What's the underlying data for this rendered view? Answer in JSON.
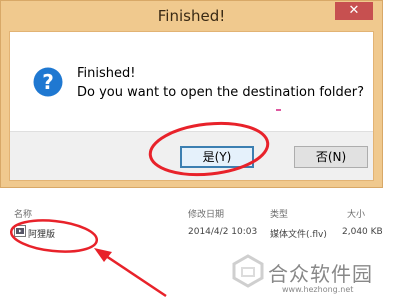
{
  "dialog": {
    "title": "Finished!",
    "close_glyph": "✕",
    "message_line1": "Finished!",
    "message_line2": "Do you want to open the destination folder?",
    "yes_label": "是(Y)",
    "no_label": "否(N)"
  },
  "file_list": {
    "columns": [
      "名称",
      "修改日期",
      "类型",
      "大小"
    ],
    "rows": [
      {
        "name": "阿狸版",
        "modified": "2014/4/2 10:03",
        "type": "媒体文件(.flv)",
        "size": "2,040 KB"
      }
    ]
  },
  "watermark": {
    "text": "合众软件园",
    "url": "www.hezhong.net"
  },
  "colors": {
    "frame": "#f0c98e",
    "close_button": "#c75050",
    "annotation_red": "#e8222a",
    "question_icon": "#1f78d1"
  }
}
